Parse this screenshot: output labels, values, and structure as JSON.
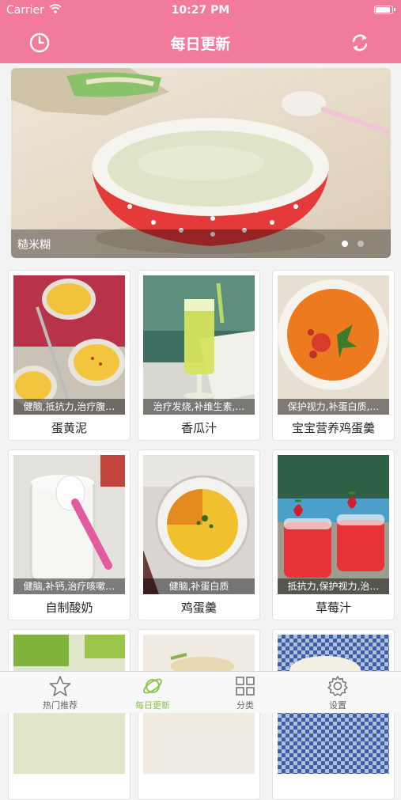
{
  "status_bar": {
    "carrier": "Carrier",
    "time": "10:27 PM"
  },
  "nav": {
    "title": "每日更新",
    "left_icon": "clock-icon",
    "right_icon": "refresh-icon"
  },
  "banner": {
    "caption": "糙米糊",
    "page_index": 1,
    "page_count": 2
  },
  "recipes": [
    {
      "name": "蛋黄泥",
      "tag": "健脑,抵抗力,治疗腹…"
    },
    {
      "name": "香瓜汁",
      "tag": "治疗发烧,补维生素,…"
    },
    {
      "name": "宝宝营养鸡蛋羹",
      "tag": "保护视力,补蛋白质,…"
    },
    {
      "name": "自制酸奶",
      "tag": "健脑,补钙,治疗咳嗽…"
    },
    {
      "name": "鸡蛋羹",
      "tag": "健脑,补蛋白质"
    },
    {
      "name": "草莓汁",
      "tag": "抵抗力,保护视力,治…"
    }
  ],
  "tabs": [
    {
      "label": "热门推荐",
      "icon": "star-icon",
      "active": false
    },
    {
      "label": "每日更新",
      "icon": "planet-icon",
      "active": true
    },
    {
      "label": "分类",
      "icon": "grid-icon",
      "active": false
    },
    {
      "label": "设置",
      "icon": "gear-icon",
      "active": false
    }
  ],
  "colors": {
    "accent": "#f27a9b",
    "tab_active": "#8bc34a"
  }
}
